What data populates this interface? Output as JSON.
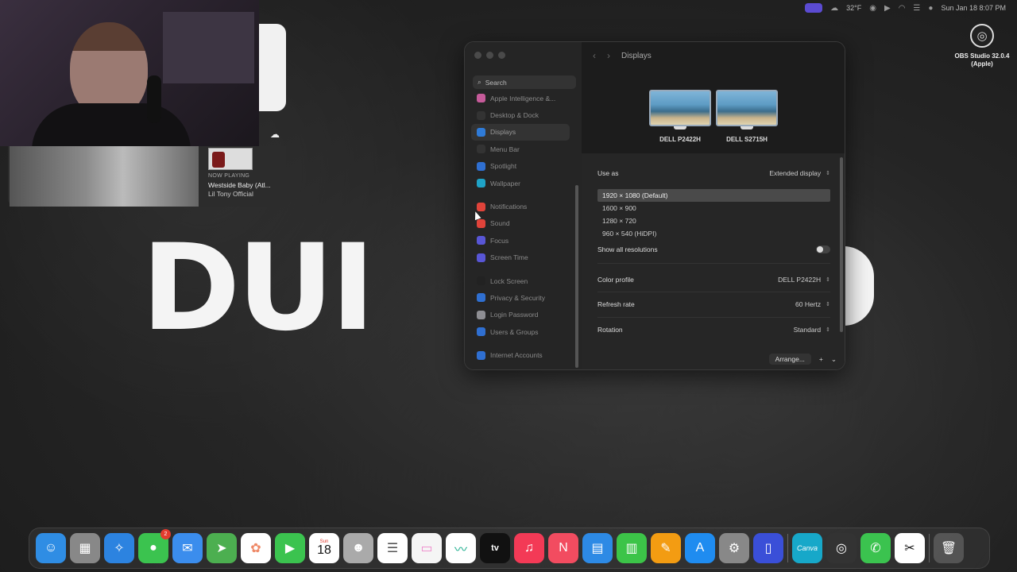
{
  "menubar": {
    "temp": "32°F",
    "datetime": "Sun Jan 18  8:07 PM"
  },
  "now_playing": {
    "label": "NOW PLAYING",
    "title": "Westside Baby (Atl...",
    "artist": "Lil Tony Official"
  },
  "desktop": {
    "logo_text": "DUI",
    "obs_label": "OBS Studio 32.0.4 (Apple)"
  },
  "window": {
    "title": "Displays",
    "search_placeholder": "Search",
    "sidebar": [
      {
        "label": "Apple Intelligence &...",
        "color": "#c65b9a",
        "group": 1
      },
      {
        "label": "Desktop & Dock",
        "color": "#333333",
        "group": 1
      },
      {
        "label": "Displays",
        "color": "#2f7bd8",
        "group": 1,
        "active": true
      },
      {
        "label": "Menu Bar",
        "color": "#333333",
        "group": 1
      },
      {
        "label": "Spotlight",
        "color": "#2f6fd1",
        "group": 1
      },
      {
        "label": "Wallpaper",
        "color": "#1fa3c7",
        "group": 1
      },
      {
        "label": "Notifications",
        "color": "#e0433a",
        "group": 2
      },
      {
        "label": "Sound",
        "color": "#e0433a",
        "group": 2
      },
      {
        "label": "Focus",
        "color": "#5856d6",
        "group": 2
      },
      {
        "label": "Screen Time",
        "color": "#5856d6",
        "group": 2
      },
      {
        "label": "Lock Screen",
        "color": "#222222",
        "group": 3
      },
      {
        "label": "Privacy & Security",
        "color": "#2f6fd1",
        "group": 3
      },
      {
        "label": "Login Password",
        "color": "#8e8e93",
        "group": 3
      },
      {
        "label": "Users & Groups",
        "color": "#2f6fd1",
        "group": 3
      },
      {
        "label": "Internet Accounts",
        "color": "#2f6fd1",
        "group": 4
      }
    ],
    "monitors": [
      {
        "name": "DELL P2422H"
      },
      {
        "name": "DELL S2715H"
      }
    ],
    "use_as": {
      "label": "Use as",
      "value": "Extended display"
    },
    "resolutions": [
      {
        "label": "1920 × 1080 (Default)",
        "selected": true
      },
      {
        "label": "1600 × 900"
      },
      {
        "label": "1280 × 720"
      },
      {
        "label": "960 × 540 (HiDPI)"
      }
    ],
    "show_all": {
      "label": "Show all resolutions",
      "on": false
    },
    "color_profile": {
      "label": "Color profile",
      "value": "DELL P2422H"
    },
    "refresh_rate": {
      "label": "Refresh rate",
      "value": "60 Hertz"
    },
    "rotation": {
      "label": "Rotation",
      "value": "Standard"
    },
    "footer": {
      "arrange": "Arrange...",
      "plus": "+",
      "chev": "⌄"
    }
  },
  "dock": {
    "calendar_month": "Sun",
    "calendar_day": "18",
    "messages_badge": "2",
    "tv_label": "tv",
    "canva_label": "Canva"
  }
}
